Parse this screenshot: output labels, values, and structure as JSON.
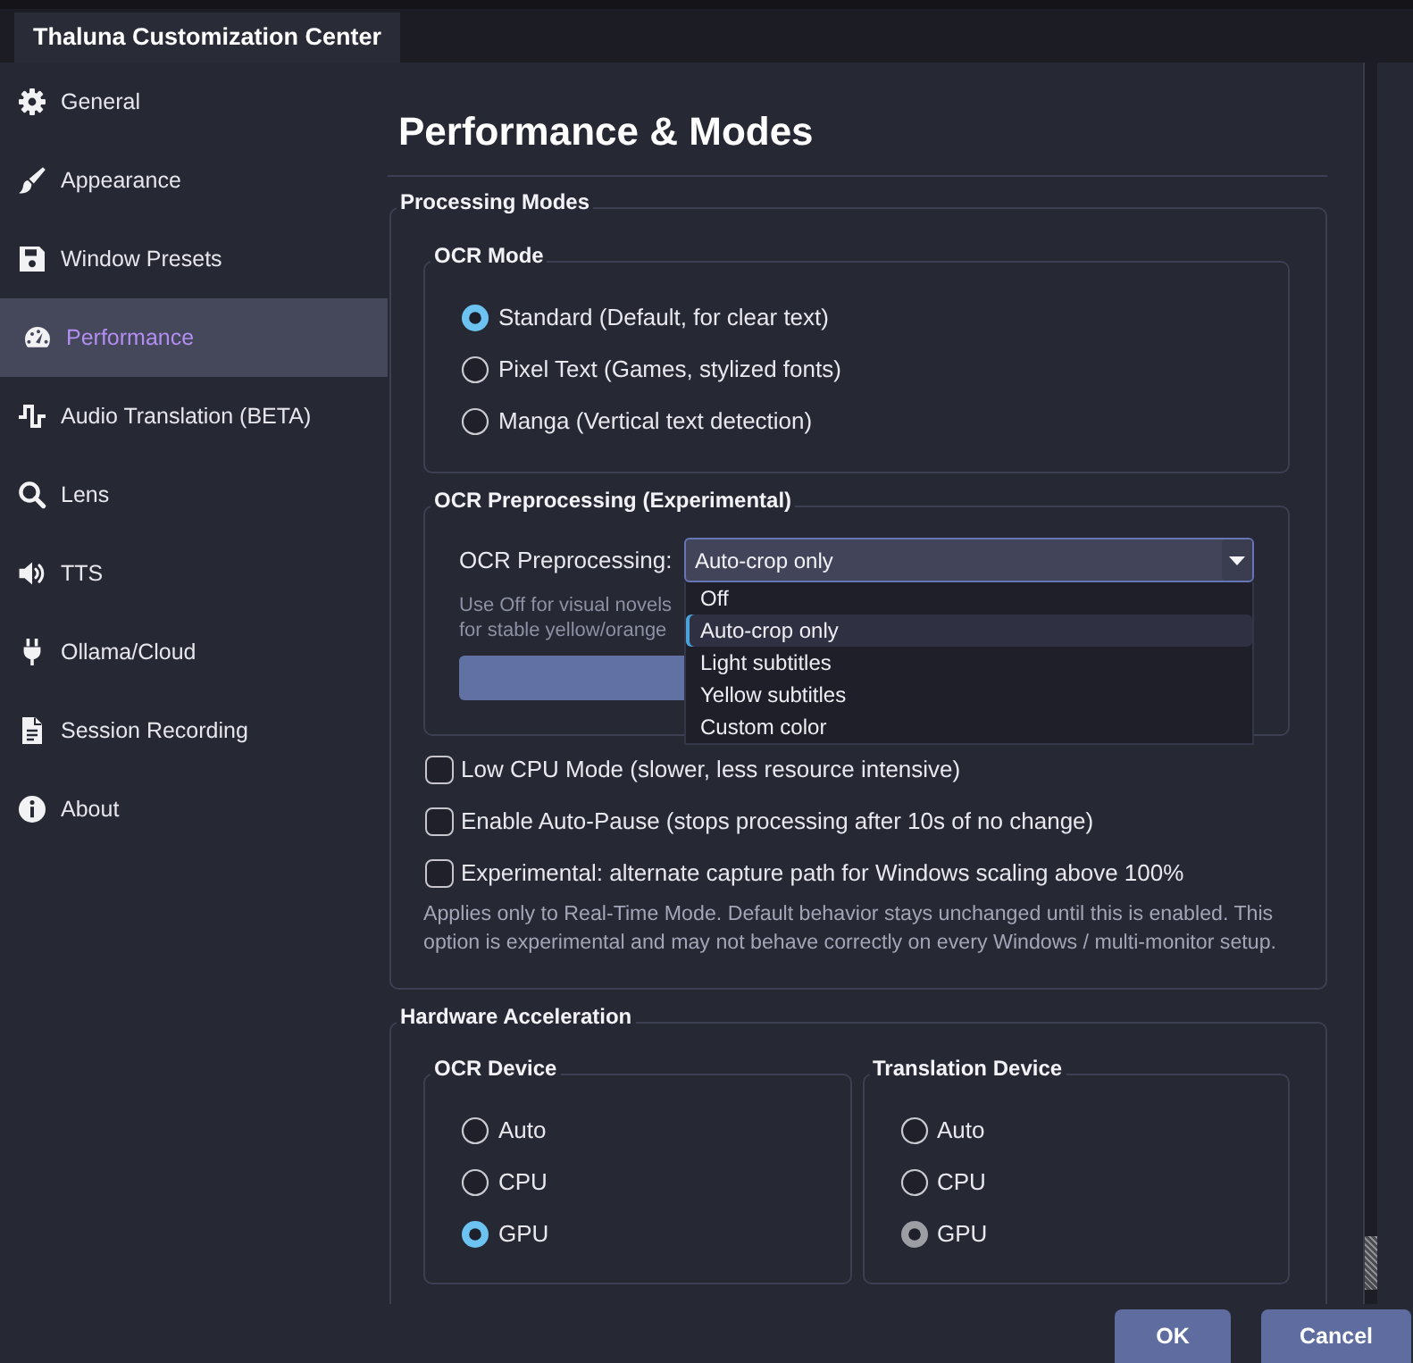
{
  "window": {
    "title": "Thaluna Customization Center"
  },
  "sidebar": {
    "items": [
      {
        "label": "General",
        "selected": false
      },
      {
        "label": "Appearance",
        "selected": false
      },
      {
        "label": "Window Presets",
        "selected": false
      },
      {
        "label": "Performance",
        "selected": true
      },
      {
        "label": "Audio Translation (BETA)",
        "selected": false
      },
      {
        "label": "Lens",
        "selected": false
      },
      {
        "label": "TTS",
        "selected": false
      },
      {
        "label": "Ollama/Cloud",
        "selected": false
      },
      {
        "label": "Session Recording",
        "selected": false
      },
      {
        "label": "About",
        "selected": false
      }
    ]
  },
  "page": {
    "title": "Performance & Modes"
  },
  "processing_modes": {
    "title": "Processing Modes",
    "ocr_mode": {
      "title": "OCR Mode",
      "options": [
        {
          "label": "Standard (Default, for clear text)",
          "selected": true
        },
        {
          "label": "Pixel Text (Games, stylized fonts)",
          "selected": false
        },
        {
          "label": "Manga (Vertical text detection)",
          "selected": false
        }
      ]
    },
    "ocr_preprocessing": {
      "title": "OCR Preprocessing (Experimental)",
      "label": "OCR Preprocessing:",
      "value": "Auto-crop only",
      "expanded": true,
      "options": [
        {
          "label": "Off",
          "selected": false
        },
        {
          "label": "Auto-crop only",
          "selected": true
        },
        {
          "label": "Light subtitles",
          "selected": false
        },
        {
          "label": "Yellow subtitles",
          "selected": false
        },
        {
          "label": "Custom color",
          "selected": false
        }
      ],
      "hint_lines": [
        "Use Off for visual novels",
        "for stable yellow/orange"
      ]
    },
    "checkboxes": [
      {
        "label": "Low CPU Mode (slower, less resource intensive)",
        "checked": false
      },
      {
        "label": "Enable Auto-Pause (stops processing after 10s of no change)",
        "checked": false
      },
      {
        "label": "Experimental: alternate capture path for Windows scaling above 100%",
        "checked": false
      }
    ],
    "note": "Applies only to Real-Time Mode. Default behavior stays unchanged until this is enabled. This option is experimental and may not behave correctly on every Windows / multi-monitor setup."
  },
  "hardware_acceleration": {
    "title": "Hardware Acceleration",
    "groups": [
      {
        "title": "OCR Device",
        "options": [
          {
            "label": "Auto",
            "selected": false,
            "disabled": false
          },
          {
            "label": "CPU",
            "selected": false,
            "disabled": false
          },
          {
            "label": "GPU",
            "selected": true,
            "disabled": false
          }
        ]
      },
      {
        "title": "Translation Device",
        "options": [
          {
            "label": "Auto",
            "selected": false,
            "disabled": false
          },
          {
            "label": "CPU",
            "selected": false,
            "disabled": false
          },
          {
            "label": "GPU",
            "selected": true,
            "disabled": true
          }
        ]
      }
    ]
  },
  "buttons": [
    {
      "label": "OK"
    },
    {
      "label": "Cancel"
    }
  ]
}
